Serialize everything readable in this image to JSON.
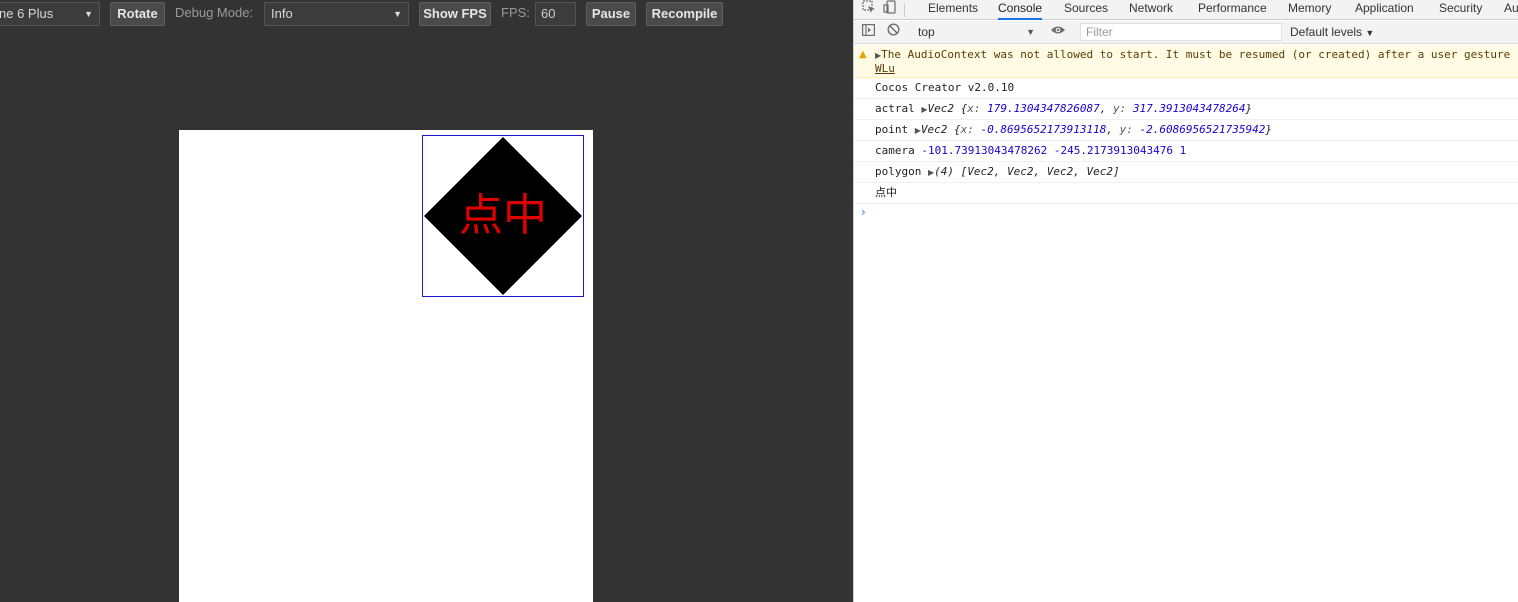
{
  "preview": {
    "device": "ne 6 Plus",
    "rotate": "Rotate",
    "debug_mode_label": "Debug Mode:",
    "debug_mode_value": "Info",
    "show_fps": "Show FPS",
    "fps_label": "FPS:",
    "fps_value": "60",
    "pause": "Pause",
    "recompile": "Recompile",
    "diamond_label": "点中"
  },
  "devtools": {
    "tabs": [
      "Elements",
      "Console",
      "Sources",
      "Network",
      "Performance",
      "Memory",
      "Application",
      "Security",
      "Au"
    ],
    "active_tab": "Console",
    "context": "top",
    "filter_placeholder": "Filter",
    "levels": "Default levels",
    "warning": {
      "text": "The AudioContext was not allowed to start. It must be resumed (or created) after a user gesture",
      "link": "WLu"
    },
    "messages": {
      "m1": "Cocos Creator v2.0.10",
      "m2_label": "actral",
      "m2_type": "Vec2",
      "m2_x": "179.1304347826087",
      "m2_y": "317.3913043478264",
      "m3_label": "point",
      "m3_type": "Vec2",
      "m3_x": "-0.8695652173913118",
      "m3_y": "-2.6086956521735942",
      "m4_label": "camera",
      "m4_values": "-101.73913043478262 -245.2173913043476 1",
      "m5_label": "polygon",
      "m5_count": "(4)",
      "m5_values": "[Vec2, Vec2, Vec2, Vec2]",
      "m6": "点中"
    }
  },
  "colors": {
    "preview_bg": "#333333",
    "diamond": "#000000",
    "diamond_text": "#e00000",
    "hit_box": "#1a1ad6",
    "active_tab_underline": "#1a73e8",
    "number": "#1c00cf"
  }
}
